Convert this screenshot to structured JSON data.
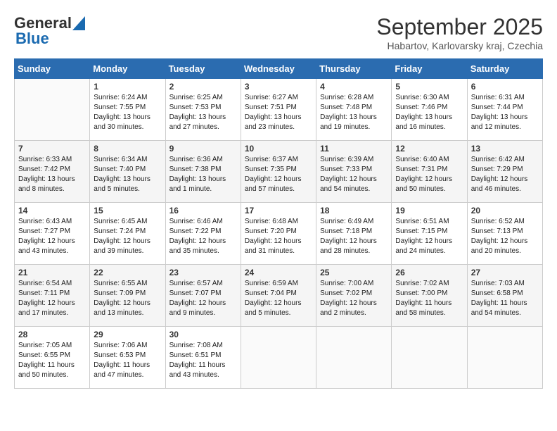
{
  "header": {
    "logo_general": "General",
    "logo_blue": "Blue",
    "month_title": "September 2025",
    "location": "Habartov, Karlovarsky kraj, Czechia"
  },
  "days_of_week": [
    "Sunday",
    "Monday",
    "Tuesday",
    "Wednesday",
    "Thursday",
    "Friday",
    "Saturday"
  ],
  "weeks": [
    [
      {
        "day": "",
        "info": ""
      },
      {
        "day": "1",
        "info": "Sunrise: 6:24 AM\nSunset: 7:55 PM\nDaylight: 13 hours\nand 30 minutes."
      },
      {
        "day": "2",
        "info": "Sunrise: 6:25 AM\nSunset: 7:53 PM\nDaylight: 13 hours\nand 27 minutes."
      },
      {
        "day": "3",
        "info": "Sunrise: 6:27 AM\nSunset: 7:51 PM\nDaylight: 13 hours\nand 23 minutes."
      },
      {
        "day": "4",
        "info": "Sunrise: 6:28 AM\nSunset: 7:48 PM\nDaylight: 13 hours\nand 19 minutes."
      },
      {
        "day": "5",
        "info": "Sunrise: 6:30 AM\nSunset: 7:46 PM\nDaylight: 13 hours\nand 16 minutes."
      },
      {
        "day": "6",
        "info": "Sunrise: 6:31 AM\nSunset: 7:44 PM\nDaylight: 13 hours\nand 12 minutes."
      }
    ],
    [
      {
        "day": "7",
        "info": "Sunrise: 6:33 AM\nSunset: 7:42 PM\nDaylight: 13 hours\nand 8 minutes."
      },
      {
        "day": "8",
        "info": "Sunrise: 6:34 AM\nSunset: 7:40 PM\nDaylight: 13 hours\nand 5 minutes."
      },
      {
        "day": "9",
        "info": "Sunrise: 6:36 AM\nSunset: 7:38 PM\nDaylight: 13 hours\nand 1 minute."
      },
      {
        "day": "10",
        "info": "Sunrise: 6:37 AM\nSunset: 7:35 PM\nDaylight: 12 hours\nand 57 minutes."
      },
      {
        "day": "11",
        "info": "Sunrise: 6:39 AM\nSunset: 7:33 PM\nDaylight: 12 hours\nand 54 minutes."
      },
      {
        "day": "12",
        "info": "Sunrise: 6:40 AM\nSunset: 7:31 PM\nDaylight: 12 hours\nand 50 minutes."
      },
      {
        "day": "13",
        "info": "Sunrise: 6:42 AM\nSunset: 7:29 PM\nDaylight: 12 hours\nand 46 minutes."
      }
    ],
    [
      {
        "day": "14",
        "info": "Sunrise: 6:43 AM\nSunset: 7:27 PM\nDaylight: 12 hours\nand 43 minutes."
      },
      {
        "day": "15",
        "info": "Sunrise: 6:45 AM\nSunset: 7:24 PM\nDaylight: 12 hours\nand 39 minutes."
      },
      {
        "day": "16",
        "info": "Sunrise: 6:46 AM\nSunset: 7:22 PM\nDaylight: 12 hours\nand 35 minutes."
      },
      {
        "day": "17",
        "info": "Sunrise: 6:48 AM\nSunset: 7:20 PM\nDaylight: 12 hours\nand 31 minutes."
      },
      {
        "day": "18",
        "info": "Sunrise: 6:49 AM\nSunset: 7:18 PM\nDaylight: 12 hours\nand 28 minutes."
      },
      {
        "day": "19",
        "info": "Sunrise: 6:51 AM\nSunset: 7:15 PM\nDaylight: 12 hours\nand 24 minutes."
      },
      {
        "day": "20",
        "info": "Sunrise: 6:52 AM\nSunset: 7:13 PM\nDaylight: 12 hours\nand 20 minutes."
      }
    ],
    [
      {
        "day": "21",
        "info": "Sunrise: 6:54 AM\nSunset: 7:11 PM\nDaylight: 12 hours\nand 17 minutes."
      },
      {
        "day": "22",
        "info": "Sunrise: 6:55 AM\nSunset: 7:09 PM\nDaylight: 12 hours\nand 13 minutes."
      },
      {
        "day": "23",
        "info": "Sunrise: 6:57 AM\nSunset: 7:07 PM\nDaylight: 12 hours\nand 9 minutes."
      },
      {
        "day": "24",
        "info": "Sunrise: 6:59 AM\nSunset: 7:04 PM\nDaylight: 12 hours\nand 5 minutes."
      },
      {
        "day": "25",
        "info": "Sunrise: 7:00 AM\nSunset: 7:02 PM\nDaylight: 12 hours\nand 2 minutes."
      },
      {
        "day": "26",
        "info": "Sunrise: 7:02 AM\nSunset: 7:00 PM\nDaylight: 11 hours\nand 58 minutes."
      },
      {
        "day": "27",
        "info": "Sunrise: 7:03 AM\nSunset: 6:58 PM\nDaylight: 11 hours\nand 54 minutes."
      }
    ],
    [
      {
        "day": "28",
        "info": "Sunrise: 7:05 AM\nSunset: 6:55 PM\nDaylight: 11 hours\nand 50 minutes."
      },
      {
        "day": "29",
        "info": "Sunrise: 7:06 AM\nSunset: 6:53 PM\nDaylight: 11 hours\nand 47 minutes."
      },
      {
        "day": "30",
        "info": "Sunrise: 7:08 AM\nSunset: 6:51 PM\nDaylight: 11 hours\nand 43 minutes."
      },
      {
        "day": "",
        "info": ""
      },
      {
        "day": "",
        "info": ""
      },
      {
        "day": "",
        "info": ""
      },
      {
        "day": "",
        "info": ""
      }
    ]
  ]
}
